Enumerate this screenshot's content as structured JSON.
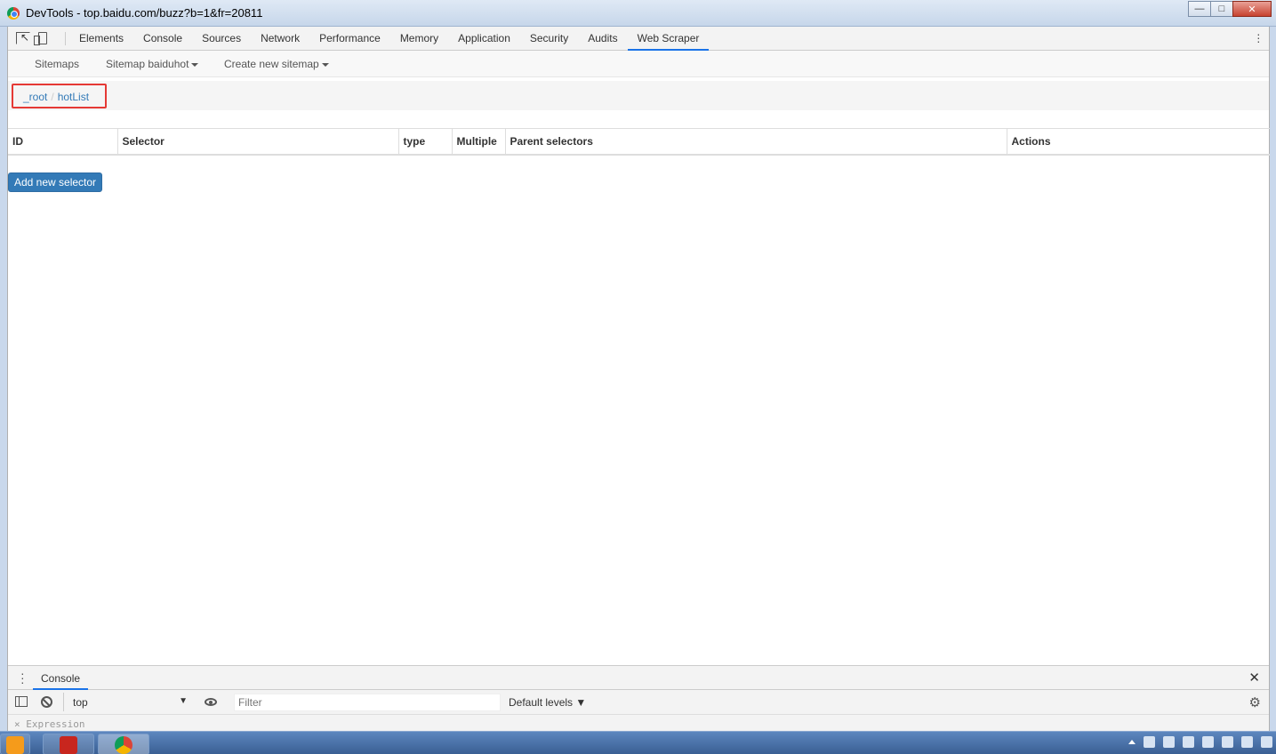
{
  "window": {
    "title": "DevTools - top.baidu.com/buzz?b=1&fr=20811",
    "controls": {
      "minimize": "—",
      "maximize": "□",
      "close": "✕"
    }
  },
  "devtools": {
    "tabs": [
      "Elements",
      "Console",
      "Sources",
      "Network",
      "Performance",
      "Memory",
      "Application",
      "Security",
      "Audits",
      "Web Scraper"
    ],
    "active_tab": "Web Scraper"
  },
  "scraper_nav": {
    "sitemaps": "Sitemaps",
    "sitemap_menu": "Sitemap baiduhot",
    "create_menu": "Create new sitemap"
  },
  "breadcrumb": {
    "root": "_root",
    "separator": "/",
    "current": "hotList"
  },
  "table": {
    "columns": [
      "ID",
      "Selector",
      "type",
      "Multiple",
      "Parent selectors",
      "Actions"
    ]
  },
  "add_button": "Add new selector",
  "drawer": {
    "tab": "Console",
    "context": "top",
    "filter_placeholder": "Filter",
    "levels": "Default levels ▼",
    "expression": "× Expression"
  },
  "colors": {
    "primary_button": "#337ab7",
    "highlight_box": "#e53935",
    "active_tab_underline": "#1a73e8"
  }
}
